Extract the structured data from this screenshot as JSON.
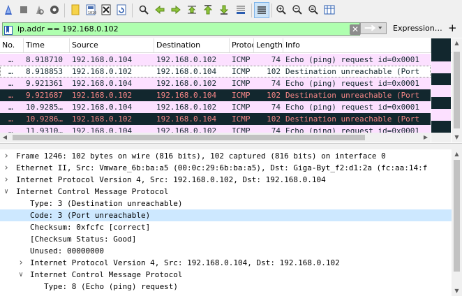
{
  "filter": {
    "value": "ip.addr == 192.168.0.102",
    "expression_label": "Expression…",
    "add_label": "+"
  },
  "columns": [
    "No.",
    "Time",
    "Source",
    "Destination",
    "Protocol",
    "Length",
    "Info"
  ],
  "packets": [
    {
      "no": "…",
      "time": "8.918710",
      "src": "192.168.0.104",
      "dst": "192.168.0.102",
      "proto": "ICMP",
      "len": "74",
      "info": "Echo (ping) request  id=0x0001",
      "kind": "echo"
    },
    {
      "no": "…",
      "time": "8.918853",
      "src": "192.168.0.102",
      "dst": "192.168.0.104",
      "proto": "ICMP",
      "len": "102",
      "info": "Destination unreachable (Port",
      "kind": "unr-sel"
    },
    {
      "no": "…",
      "time": "9.921361",
      "src": "192.168.0.104",
      "dst": "192.168.0.102",
      "proto": "ICMP",
      "len": "74",
      "info": "Echo (ping) request  id=0x0001",
      "kind": "echo"
    },
    {
      "no": "…",
      "time": "9.921687",
      "src": "192.168.0.102",
      "dst": "192.168.0.104",
      "proto": "ICMP",
      "len": "102",
      "info": "Destination unreachable (Port",
      "kind": "unr"
    },
    {
      "no": "…",
      "time": "10.9285…",
      "src": "192.168.0.104",
      "dst": "192.168.0.102",
      "proto": "ICMP",
      "len": "74",
      "info": "Echo (ping) request  id=0x0001",
      "kind": "echo"
    },
    {
      "no": "…",
      "time": "10.9286…",
      "src": "192.168.0.102",
      "dst": "192.168.0.104",
      "proto": "ICMP",
      "len": "102",
      "info": "Destination unreachable (Port",
      "kind": "unr"
    },
    {
      "no": "…",
      "time": "11.9310…",
      "src": "192.168.0.104",
      "dst": "192.168.0.102",
      "proto": "ICMP",
      "len": "74",
      "info": "Echo (ping) request  id=0x0001",
      "kind": "echo"
    }
  ],
  "details": [
    {
      "text": "Frame 1246: 102 bytes on wire (816 bits), 102 captured (816 bits) on interface 0",
      "level": 0,
      "state": "collapsed"
    },
    {
      "text": "Ethernet II, Src: Vmware_6b:ba:a5 (00:0c:29:6b:ba:a5), Dst: Giga-Byt_f2:d1:2a (fc:aa:14:f",
      "level": 0,
      "state": "collapsed"
    },
    {
      "text": "Internet Protocol Version 4, Src: 192.168.0.102, Dst: 192.168.0.104",
      "level": 0,
      "state": "collapsed"
    },
    {
      "text": "Internet Control Message Protocol",
      "level": 0,
      "state": "expanded"
    },
    {
      "text": "Type: 3 (Destination unreachable)",
      "level": 1,
      "state": "leaf"
    },
    {
      "text": "Code: 3 (Port unreachable)",
      "level": 1,
      "state": "leaf",
      "selected": true
    },
    {
      "text": "Checksum: 0xfcfc [correct]",
      "level": 1,
      "state": "leaf"
    },
    {
      "text": "[Checksum Status: Good]",
      "level": 1,
      "state": "leaf"
    },
    {
      "text": "Unused: 00000000",
      "level": 1,
      "state": "leaf"
    },
    {
      "text": "Internet Protocol Version 4, Src: 192.168.0.104, Dst: 192.168.0.102",
      "level": 1,
      "state": "collapsed"
    },
    {
      "text": "Internet Control Message Protocol",
      "level": 1,
      "state": "expanded"
    },
    {
      "text": "Type: 8 (Echo (ping) request)",
      "level": 2,
      "state": "leaf"
    }
  ],
  "colors": {
    "filter_valid_bg": "#afffaf",
    "icmp_echo_bg": "#fce0ff",
    "icmp_error_bg": "#12272e",
    "icmp_error_fg": "#f78787",
    "detail_selected_bg": "#cde8ff"
  },
  "toolbar_icons": [
    "start-capture-icon",
    "stop-capture-icon",
    "restart-capture-icon",
    "capture-options-icon",
    "open-file-icon",
    "save-file-icon",
    "close-file-icon",
    "reload-file-icon",
    "find-packet-icon",
    "go-back-icon",
    "go-forward-icon",
    "go-to-packet-icon",
    "go-first-icon",
    "go-last-icon",
    "auto-scroll-icon",
    "colorize-icon",
    "zoom-in-icon",
    "zoom-out-icon",
    "normal-size-icon",
    "resize-columns-icon"
  ]
}
